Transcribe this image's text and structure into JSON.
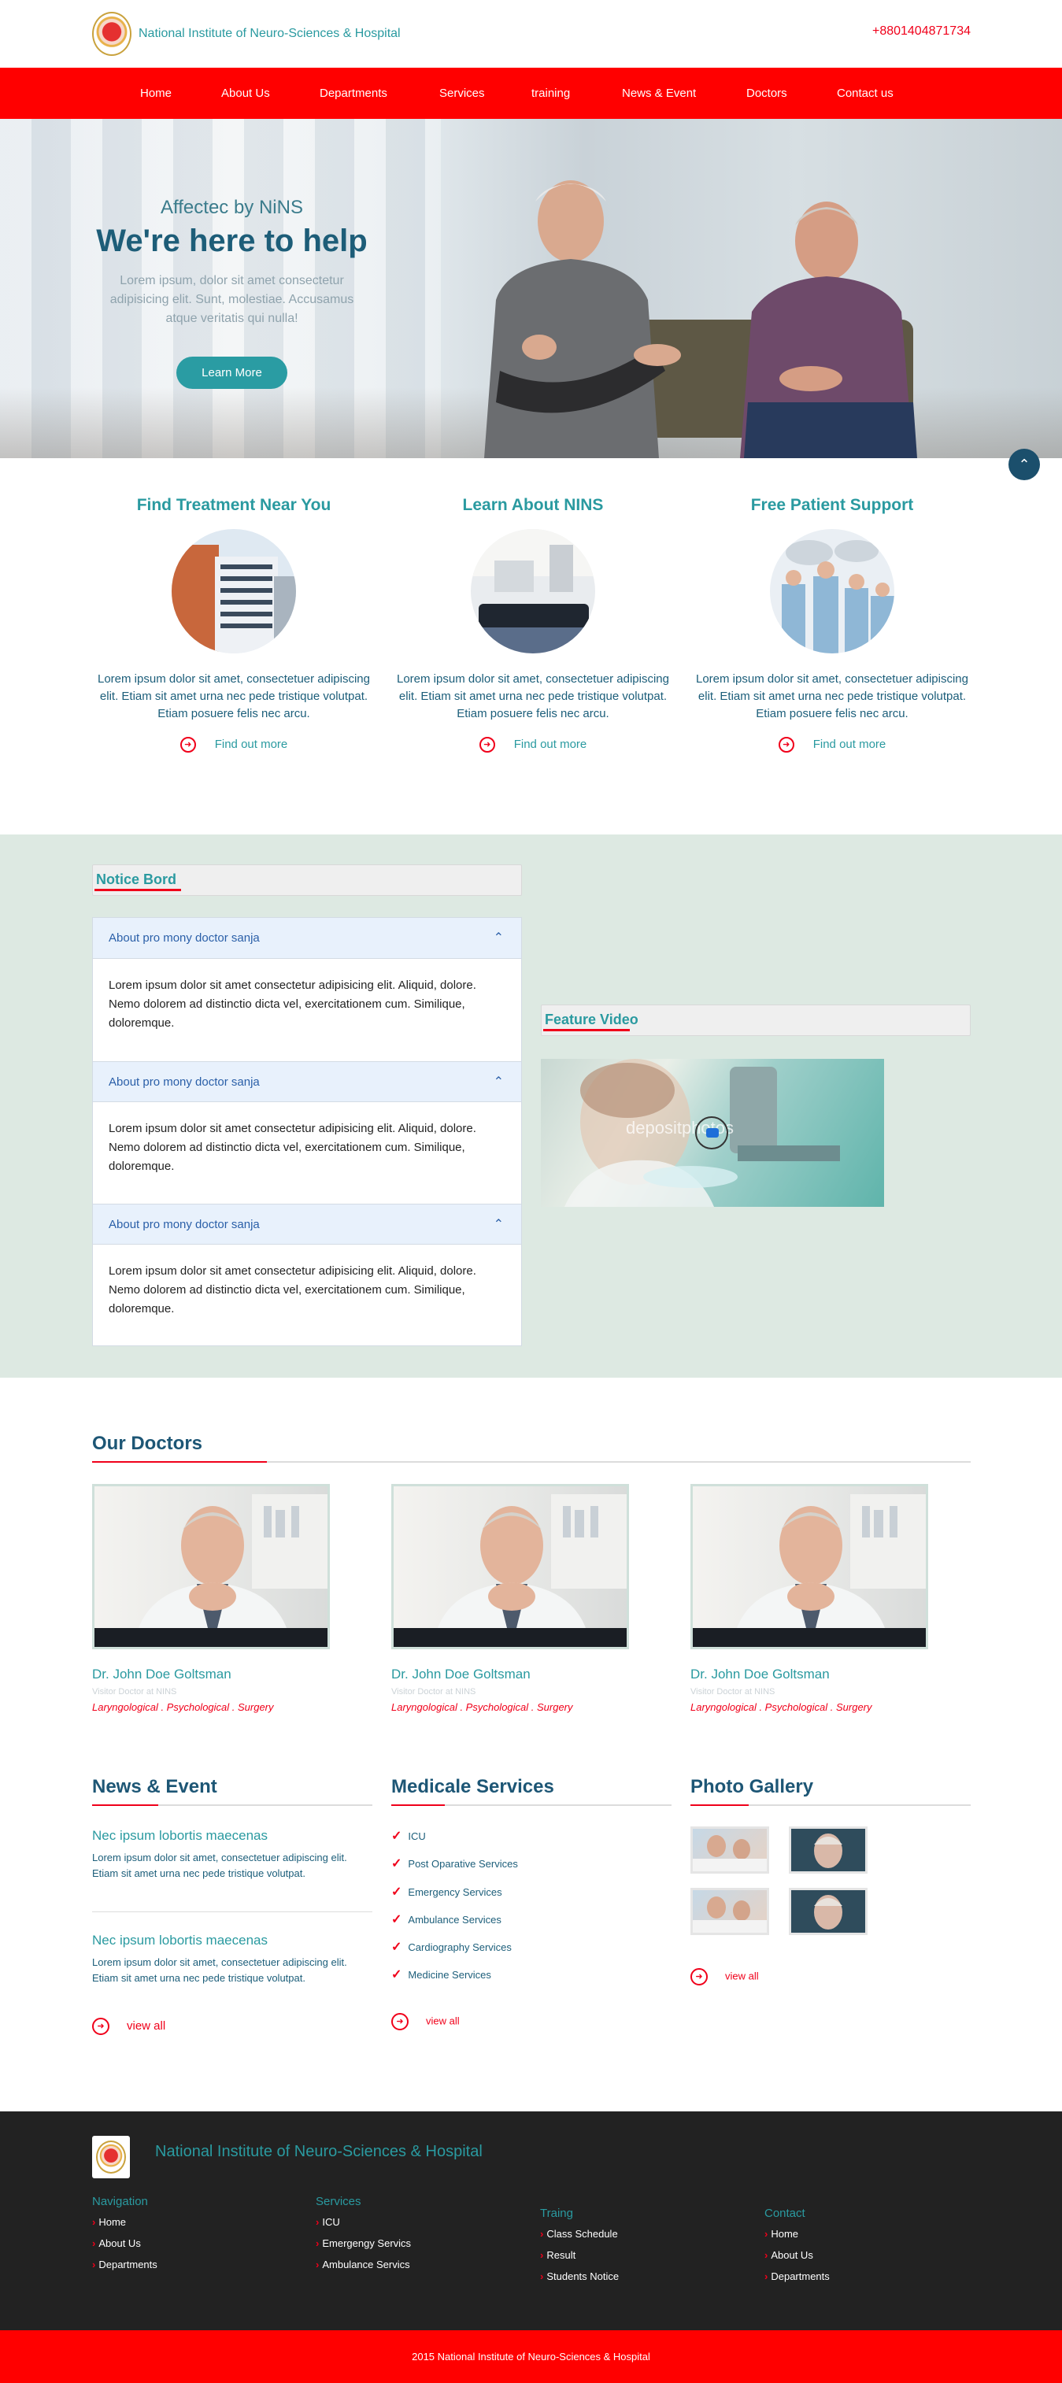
{
  "header": {
    "site_name": "National Institute of Neuro-Sciences & Hospital",
    "phone": "+8801404871734"
  },
  "nav": [
    "Home",
    "About Us",
    "Departments",
    "Services",
    "training",
    "News & Event",
    "Doctors",
    "Contact us"
  ],
  "hero": {
    "subtitle": "Affectec by NiNS",
    "title": "We're here to help",
    "text": "Lorem ipsum, dolor sit amet consectetur adipisicing elit. Sunt, molestiae. Accusamus atque veritatis qui nulla!",
    "button": "Learn More"
  },
  "features": [
    {
      "title": "Find Treatment Near You",
      "text": "Lorem ipsum dolor sit amet, consectetuer adipiscing elit. Etiam sit amet urna nec pede tristique volutpat. Etiam posuere felis nec arcu.",
      "link": "Find out more"
    },
    {
      "title": "Learn About NINS",
      "text": "Lorem ipsum dolor sit amet, consectetuer adipiscing elit. Etiam sit amet urna nec pede tristique volutpat. Etiam posuere felis nec arcu.",
      "link": "Find out more"
    },
    {
      "title": "Free Patient Support",
      "text": "Lorem ipsum dolor sit amet, consectetuer adipiscing elit. Etiam sit amet urna nec pede tristique volutpat. Etiam posuere felis nec arcu.",
      "link": "Find out more"
    }
  ],
  "notice": {
    "heading": "Notice Bord",
    "items": [
      {
        "title": "About pro mony doctor sanja",
        "body": "Lorem ipsum dolor sit amet consectetur adipisicing elit. Aliquid, dolore. Nemo dolorem ad distinctio dicta vel, exercitationem cum. Similique, doloremque."
      },
      {
        "title": "About pro mony doctor sanja",
        "body": "Lorem ipsum dolor sit amet consectetur adipisicing elit. Aliquid, dolore. Nemo dolorem ad distinctio dicta vel, exercitationem cum. Similique, doloremque."
      },
      {
        "title": "About pro mony doctor sanja",
        "body": "Lorem ipsum dolor sit amet consectetur adipisicing elit. Aliquid, dolore. Nemo dolorem ad distinctio dicta vel, exercitationem cum. Similique, doloremque."
      }
    ]
  },
  "video": {
    "heading": "Feature Video",
    "watermark": "depositphotos"
  },
  "doctors": {
    "heading": "Our Doctors",
    "items": [
      {
        "name": "Dr. John Doe Goltsman",
        "role": "Visitor Doctor at NINS",
        "spec": "Laryngological . Psychological . Surgery"
      },
      {
        "name": "Dr. John Doe Goltsman",
        "role": "Visitor Doctor at NINS",
        "spec": "Laryngological . Psychological . Surgery"
      },
      {
        "name": "Dr. John Doe Goltsman",
        "role": "Visitor Doctor at NINS",
        "spec": "Laryngological . Psychological . Surgery"
      }
    ]
  },
  "news": {
    "heading": "News & Event",
    "items": [
      {
        "title": "Nec ipsum lobortis maecenas",
        "text": "Lorem ipsum dolor sit amet, consectetuer adipiscing elit. Etiam sit amet urna nec pede tristique volutpat."
      },
      {
        "title": "Nec ipsum lobortis maecenas",
        "text": "Lorem ipsum dolor sit amet, consectetuer adipiscing elit. Etiam sit amet urna nec pede tristique volutpat."
      }
    ],
    "view_all": "view all"
  },
  "services": {
    "heading": "Medicale Services",
    "items": [
      "ICU",
      "Post Oparative Services",
      "Emergency Services",
      "Ambulance Services",
      "Cardiography Services",
      "Medicine Services"
    ],
    "view_all": "view all"
  },
  "gallery": {
    "heading": "Photo Gallery",
    "view_all": "view all"
  },
  "footer": {
    "title": "National Institute of Neuro-Sciences & Hospital",
    "cols": [
      {
        "heading": "Navigation",
        "items": [
          "Home",
          "About Us",
          "Departments"
        ]
      },
      {
        "heading": "Services",
        "items": [
          "ICU",
          "Emergengy Servics",
          "Ambulance Servics"
        ]
      },
      {
        "heading": "Traing",
        "items": [
          "Class Schedule",
          "Result",
          "Students Notice"
        ]
      },
      {
        "heading": "Contact",
        "items": [
          "Home",
          "About Us",
          "Departments"
        ]
      }
    ],
    "copyright": "2015 National Institute of Neuro-Sciences & Hospital"
  },
  "colors": {
    "brand_red": "#ff0000",
    "teal": "#2a9aa0",
    "navy": "#1d5675",
    "notice_bg": "#dde9e2",
    "footer_bg": "#222222"
  }
}
